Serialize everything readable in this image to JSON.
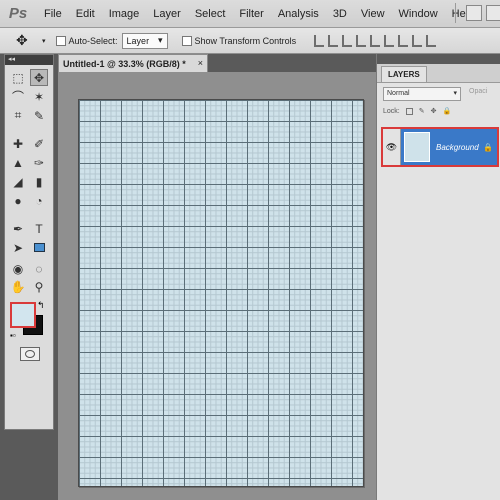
{
  "app": {
    "logo": "Ps"
  },
  "menu": [
    "File",
    "Edit",
    "Image",
    "Layer",
    "Select",
    "Filter",
    "Analysis",
    "3D",
    "View",
    "Window",
    "Help"
  ],
  "options": {
    "move_tool_icon": "move-icon",
    "auto_select_label": "Auto-Select:",
    "auto_select_value": "Layer",
    "show_transform_label": "Show Transform Controls"
  },
  "document": {
    "tab_title": "Untitled-1 @ 33.3% (RGB/8) *",
    "close": "×"
  },
  "toolbox": {
    "header": "◂◂",
    "foreground_color": "#d2e5ee",
    "background_color": "#111111"
  },
  "layers_panel": {
    "tab": "LAYERS",
    "blend_mode": "Normal",
    "opacity_label": "Opaci",
    "lock_label": "Lock:",
    "layer": {
      "name": "Background",
      "lock": "🔒",
      "eye": "👁"
    }
  }
}
